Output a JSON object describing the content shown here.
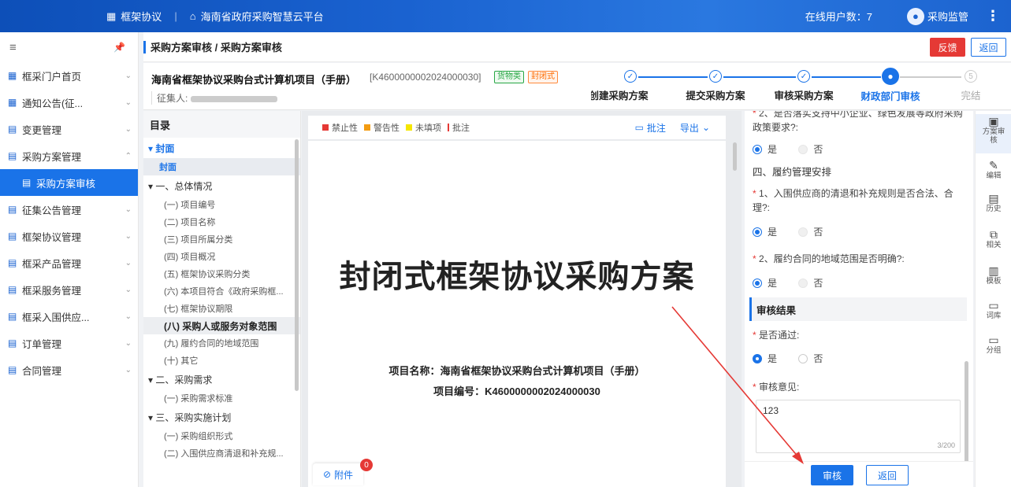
{
  "topbar": {
    "app_name": "框架协议",
    "platform": "海南省政府采购智慧云平台",
    "online_label": "在线用户数：7",
    "user_name": "采购监管"
  },
  "sidebar": {
    "items": [
      {
        "label": "框采门户首页",
        "icon": "grid-icon"
      },
      {
        "label": "通知公告(征...",
        "icon": "grid-icon"
      },
      {
        "label": "变更管理",
        "icon": "doc-icon"
      },
      {
        "label": "采购方案管理",
        "icon": "doc-icon"
      },
      {
        "label": "采购方案审核",
        "icon": "doc-icon"
      },
      {
        "label": "征集公告管理",
        "icon": "doc-icon"
      },
      {
        "label": "框架协议管理",
        "icon": "doc-icon"
      },
      {
        "label": "框采产品管理",
        "icon": "doc-icon"
      },
      {
        "label": "框采服务管理",
        "icon": "doc-icon"
      },
      {
        "label": "框采入围供应...",
        "icon": "doc-icon"
      },
      {
        "label": "订单管理",
        "icon": "doc-icon"
      },
      {
        "label": "合同管理",
        "icon": "doc-icon"
      }
    ]
  },
  "header": {
    "breadcrumb": "采购方案审核 / 采购方案审核",
    "feedback": "反馈",
    "back": "返回"
  },
  "project": {
    "title": "海南省框架协议采购台式计算机项目（手册）",
    "code": "[K4600000002024000030]",
    "tag1": "货物类",
    "tag2": "封闭式",
    "collector": "征集人:"
  },
  "steps": [
    {
      "label": "创建采购方案",
      "mark": "✓"
    },
    {
      "label": "提交采购方案",
      "mark": "✓"
    },
    {
      "label": "审核采购方案",
      "mark": "✓"
    },
    {
      "label": "财政部门审核",
      "mark": "●"
    },
    {
      "label": "完结",
      "mark": "5"
    }
  ],
  "toc": {
    "title": "目录",
    "items": [
      "▾ 封面",
      "封面",
      "▾ 一、总体情况",
      "(一) 项目编号",
      "(二) 项目名称",
      "(三) 项目所属分类",
      "(四) 项目概况",
      "(五) 框架协议采购分类",
      "(六) 本项目符合《政府采购框...",
      "(七) 框架协议期限",
      "(八) 采购人或服务对象范围",
      "(九) 履约合同的地域范围",
      "(十) 其它",
      "▾ 二、采购需求",
      "(一) 采购需求标准",
      "▾ 三、采购实施计划",
      "(一) 采购组织形式",
      "(二) 入围供应商清退和补充规..."
    ]
  },
  "doc": {
    "legend": [
      "禁止性",
      "警告性",
      "未填项",
      "批注"
    ],
    "legend_colors": [
      "#e53935",
      "#f39c12",
      "#f5e600",
      "#e53935"
    ],
    "comment": "批注",
    "export": "导出",
    "title": "封闭式框架协议采购方案",
    "project_name": "项目名称：海南省框架协议采购台式计算机项目（手册）",
    "project_code": "项目编号：K4600000002024000030",
    "attachment": "附件",
    "attachment_count": "0"
  },
  "review": {
    "top_text": "2、是否落实支持中小企业、绿色发展等政府采购政策要求?:",
    "q_partial_line": "采购政策要求?:",
    "yes": "是",
    "no": "否",
    "section4": "四、履约管理安排",
    "q1": "1、入围供应商的清退和补充规则是否合法、合理?:",
    "q2": "2、履约合同的地域范围是否明确?:",
    "result_title": "审核结果",
    "pass_label": "是否通过:",
    "opinion_label": "审核意见:",
    "opinion_value": "123",
    "counter": "3/200",
    "audit_btn": "审核",
    "return_btn": "返回"
  },
  "tools": [
    {
      "label": "方案审核",
      "icon": "review-icon"
    },
    {
      "label": "编辑",
      "icon": "edit-icon"
    },
    {
      "label": "历史",
      "icon": "history-icon"
    },
    {
      "label": "相关",
      "icon": "related-icon"
    },
    {
      "label": "模板",
      "icon": "template-icon"
    },
    {
      "label": "词库",
      "icon": "lexicon-icon"
    },
    {
      "label": "分组",
      "icon": "group-icon"
    }
  ]
}
